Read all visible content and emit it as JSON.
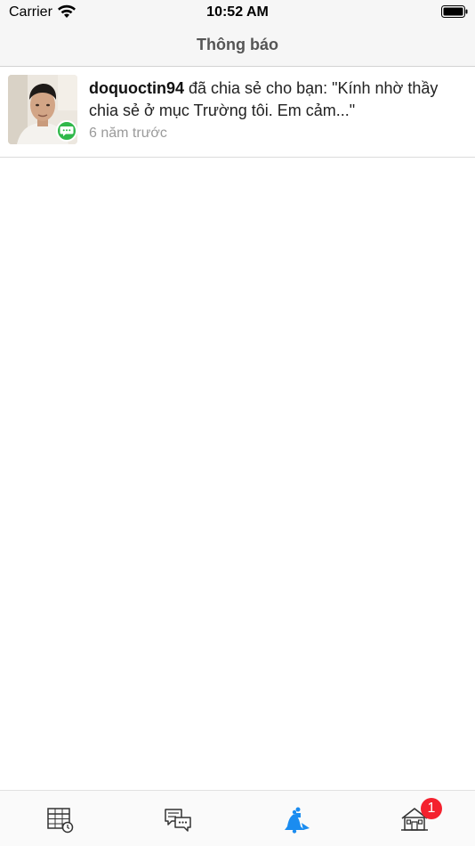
{
  "status_bar": {
    "carrier": "Carrier",
    "time": "10:52 AM",
    "wifi_icon": "wifi-icon",
    "battery_icon": "battery-icon"
  },
  "nav": {
    "title": "Thông báo"
  },
  "notifications": [
    {
      "user": "doquoctin94",
      "message": " đã chia sẻ cho bạn: \"Kính nhờ thầy chia sẻ ở mục Trường tôi. Em cảm...\"",
      "time": "6 năm trước",
      "badge_icon": "chat-bubble-icon",
      "badge_color": "#2fb84a"
    }
  ],
  "tab_bar": {
    "tabs": [
      {
        "icon": "timetable-icon",
        "active": false
      },
      {
        "icon": "messages-icon",
        "active": false
      },
      {
        "icon": "notifications-icon",
        "active": true
      },
      {
        "icon": "school-icon",
        "active": false,
        "badge": "1"
      }
    ],
    "active_color": "#1a8cf0",
    "inactive_color": "#333333",
    "badge_color": "#f4212e"
  }
}
